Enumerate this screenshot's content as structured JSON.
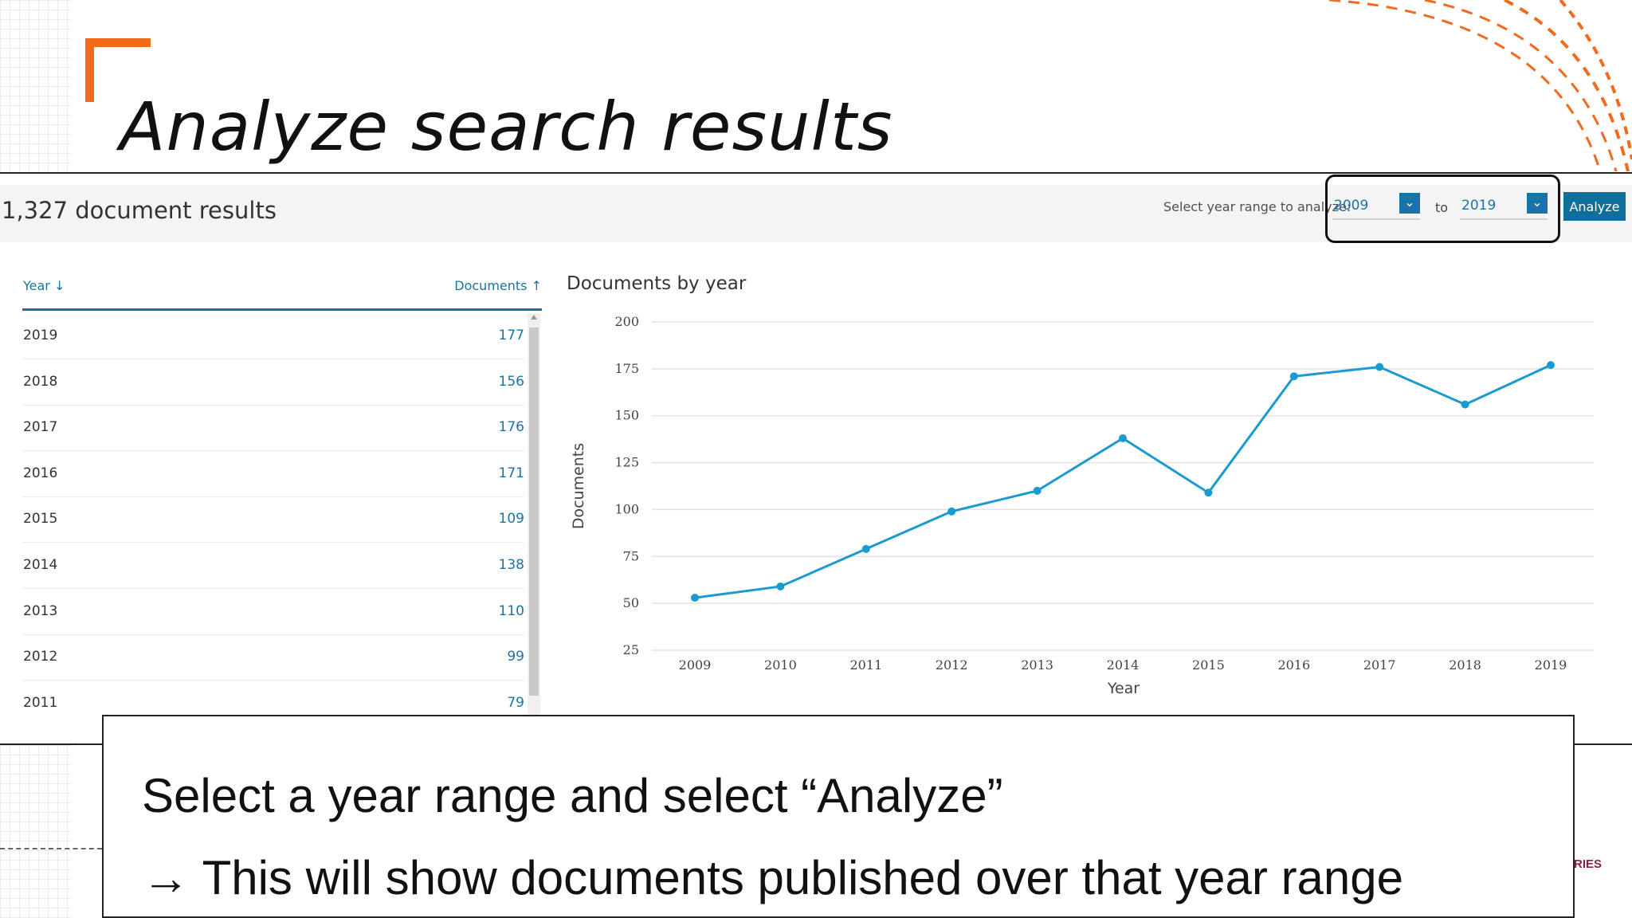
{
  "slide": {
    "title": "Analyze search results",
    "corner_text": "RIES",
    "caption_line1": "Select a year range and select “Analyze”",
    "caption_line2": "→ This will show documents published over that year range",
    "accent_color": "#f26a1b"
  },
  "results": {
    "count_text": "1,327 document results",
    "range_label": "Select year range to analyze:",
    "from_year": "2009",
    "to_label": "to",
    "to_year": "2019",
    "analyze_label": "Analyze",
    "select_chevron_icon": "chevron-down-icon"
  },
  "table": {
    "col_year": "Year",
    "col_year_icon": "arrow-down-icon",
    "col_documents": "Documents",
    "col_documents_icon": "arrow-up-icon",
    "rows": [
      {
        "year": "2019",
        "count": "177"
      },
      {
        "year": "2018",
        "count": "156"
      },
      {
        "year": "2017",
        "count": "176"
      },
      {
        "year": "2016",
        "count": "171"
      },
      {
        "year": "2015",
        "count": "109"
      },
      {
        "year": "2014",
        "count": "138"
      },
      {
        "year": "2013",
        "count": "110"
      },
      {
        "year": "2012",
        "count": "99"
      },
      {
        "year": "2011",
        "count": "79"
      }
    ]
  },
  "chart_data": {
    "type": "line",
    "title": "Documents by year",
    "xlabel": "Year",
    "ylabel": "Documents",
    "x": [
      "2009",
      "2010",
      "2011",
      "2012",
      "2013",
      "2014",
      "2015",
      "2016",
      "2017",
      "2018",
      "2019"
    ],
    "series": [
      {
        "values": [
          53,
          59,
          79,
          99,
          110,
          138,
          109,
          171,
          176,
          156,
          177
        ]
      }
    ],
    "ylim": [
      25,
      200
    ],
    "yticks": [
      25,
      50,
      75,
      100,
      125,
      150,
      175,
      200
    ],
    "grid": true,
    "line_color": "#1a9bd0"
  }
}
